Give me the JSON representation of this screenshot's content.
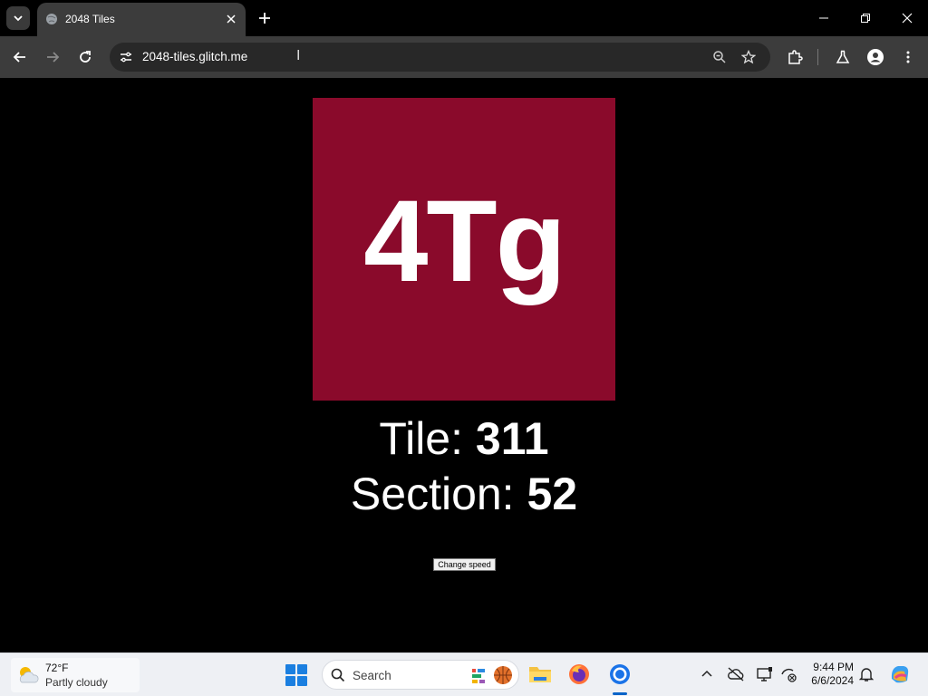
{
  "browser": {
    "tab_title": "2048 Tiles",
    "url": "2048-tiles.glitch.me"
  },
  "game": {
    "tile_label": "4Tg",
    "tile_color": "#8a0a2b",
    "tile_stat_label": "Tile: ",
    "tile_stat_value": "311",
    "section_stat_label": "Section: ",
    "section_stat_value": "52",
    "speed_button_label": "Change speed"
  },
  "taskbar": {
    "weather_temp": "72°F",
    "weather_desc": "Partly cloudy",
    "search_label": "Search",
    "time": "9:44 PM",
    "date": "6/6/2024"
  }
}
